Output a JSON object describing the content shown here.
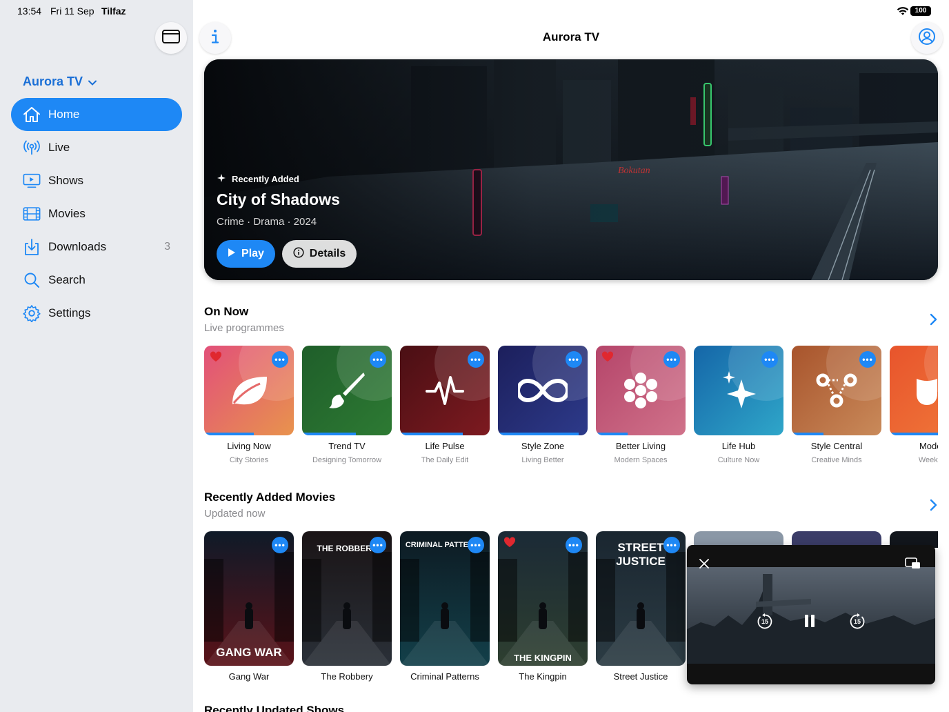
{
  "status_bar": {
    "time": "13:54",
    "date": "Fri 11 Sep",
    "carrier": "Tilfaz",
    "battery": "100"
  },
  "sidebar": {
    "brand": "Aurora TV",
    "items": [
      {
        "label": "Home",
        "icon": "house-icon",
        "active": true
      },
      {
        "label": "Live",
        "icon": "broadcast-icon"
      },
      {
        "label": "Shows",
        "icon": "tv-play-icon"
      },
      {
        "label": "Movies",
        "icon": "film-icon"
      },
      {
        "label": "Downloads",
        "icon": "download-icon",
        "badge": "3"
      },
      {
        "label": "Search",
        "icon": "magnifier-icon"
      },
      {
        "label": "Settings",
        "icon": "gear-icon"
      }
    ]
  },
  "header": {
    "title": "Aurora TV"
  },
  "hero": {
    "tag": "Recently Added",
    "title": "City of Shadows",
    "meta": "Crime · Drama · 2024",
    "play_label": "Play",
    "details_label": "Details"
  },
  "on_now": {
    "title": "On Now",
    "subtitle": "Live programmes",
    "channels": [
      {
        "name": "Living Now",
        "show": "City Stories",
        "icon": "leaf-icon",
        "colors": [
          "#e2507a",
          "#e8934d"
        ],
        "favorite": true,
        "progress": 0.55
      },
      {
        "name": "Trend TV",
        "show": "Designing Tomorrow",
        "icon": "paintbrush-icon",
        "colors": [
          "#1f5e2a",
          "#2d7a33"
        ],
        "favorite": false,
        "progress": 0.6
      },
      {
        "name": "Life Pulse",
        "show": "The Daily Edit",
        "icon": "waveform-icon",
        "colors": [
          "#4a0f14",
          "#7d1a20"
        ],
        "favorite": false,
        "progress": 0.7
      },
      {
        "name": "Style Zone",
        "show": "Living Better",
        "icon": "infinity-icon",
        "colors": [
          "#1c1f5c",
          "#2d3a8a"
        ],
        "favorite": false,
        "progress": 0.9
      },
      {
        "name": "Better Living",
        "show": "Modern Spaces",
        "icon": "flower-icon",
        "colors": [
          "#b5456a",
          "#d0728a"
        ],
        "favorite": true,
        "progress": 0.35
      },
      {
        "name": "Life Hub",
        "show": "Culture Now",
        "icon": "sparkles-icon",
        "colors": [
          "#1566a8",
          "#2fa6c9"
        ],
        "favorite": false,
        "progress": 0.0
      },
      {
        "name": "Style Central",
        "show": "Creative Minds",
        "icon": "nodes-icon",
        "colors": [
          "#a8542c",
          "#c98a5a"
        ],
        "favorite": false,
        "progress": 0.35
      },
      {
        "name": "Modern",
        "show": "Weekend",
        "icon": "mask-icon",
        "colors": [
          "#e8542c",
          "#f07a3a"
        ],
        "favorite": false,
        "progress": 0.6
      }
    ]
  },
  "recent_movies": {
    "title": "Recently Added Movies",
    "subtitle": "Updated now",
    "movies": [
      {
        "title": "Gang War",
        "poster_text": "GANG WAR",
        "colors": [
          "#0f1a28",
          "#5a1218"
        ],
        "favorite": false
      },
      {
        "title": "The Robbery",
        "poster_text": "THE ROBBERY",
        "colors": [
          "#1a1416",
          "#2a3038"
        ],
        "favorite": false
      },
      {
        "title": "Criminal Patterns",
        "poster_text": "CRIMINAL PATTERNS",
        "colors": [
          "#0d1a22",
          "#13404a"
        ],
        "favorite": false
      },
      {
        "title": "The Kingpin",
        "poster_text": "THE KINGPIN",
        "colors": [
          "#1b2a36",
          "#2e3f30"
        ],
        "favorite": true
      },
      {
        "title": "Street Justice",
        "poster_text": "STREET JUSTICE",
        "colors": [
          "#1a2630",
          "#2c3c44"
        ],
        "favorite": false
      }
    ]
  },
  "next_section": {
    "title": "Recently Updated Shows"
  },
  "pip": {
    "skip_back": "15",
    "skip_forward": "15"
  }
}
